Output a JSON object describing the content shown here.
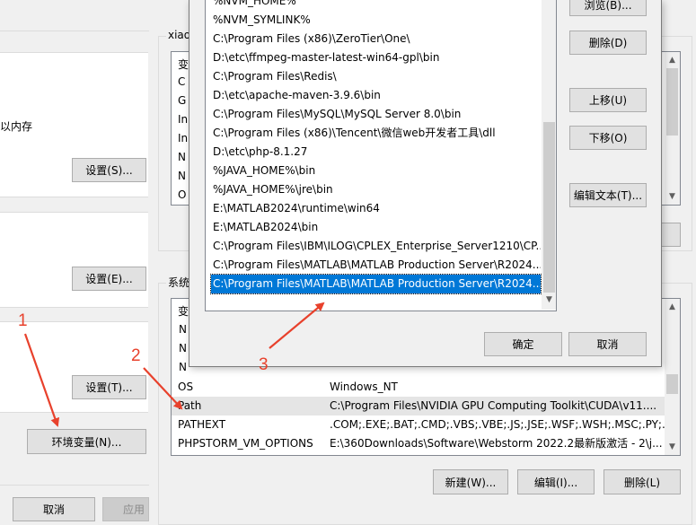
{
  "sys_props": {
    "memory_suffix": "以内存",
    "perf_settings": "设置(S)...",
    "profile_settings": "设置(E)...",
    "startup_settings": "设置(T)...",
    "env_vars_button": "环境变量(N)...",
    "cancel": "取消",
    "apply": "应用"
  },
  "env_dialog": {
    "user_group_label": "xiao",
    "user_var_fragments": [
      "变",
      "C",
      "G",
      "In",
      "In",
      "N",
      "N",
      "O"
    ],
    "system_group_label": "系统",
    "system_header_fragment": "变",
    "system_var_fragments": [
      "N",
      "N",
      "N"
    ],
    "system_vars": [
      {
        "name": "OS",
        "value": "Windows_NT"
      },
      {
        "name": "Path",
        "value": "C:\\Program Files\\NVIDIA GPU Computing Toolkit\\CUDA\\v11...."
      },
      {
        "name": "PATHEXT",
        "value": ".COM;.EXE;.BAT;.CMD;.VBS;.VBE;.JS;.JSE;.WSF;.WSH;.MSC;.PY;.P..."
      },
      {
        "name": "PHPSTORM_VM_OPTIONS",
        "value": "E:\\360Downloads\\Software\\Webstorm 2022.2最新版激活 - 2\\j..."
      }
    ],
    "new_button": "新建(W)...",
    "edit_button": "编辑(I)...",
    "delete_button": "删除(L)"
  },
  "edit_dialog": {
    "paths": [
      "%NVM_HOME%",
      "%NVM_SYMLINK%",
      "C:\\Program Files (x86)\\ZeroTier\\One\\",
      "D:\\etc\\ffmpeg-master-latest-win64-gpl\\bin",
      "C:\\Program Files\\Redis\\",
      "D:\\etc\\apache-maven-3.9.6\\bin",
      "C:\\Program Files\\MySQL\\MySQL Server 8.0\\bin",
      "C:\\Program Files (x86)\\Tencent\\微信web开发者工具\\dll",
      "D:\\etc\\php-8.1.27",
      "%JAVA_HOME%\\bin",
      "%JAVA_HOME%\\jre\\bin",
      "E:\\MATLAB2024\\runtime\\win64",
      "E:\\MATLAB2024\\bin",
      "C:\\Program Files\\IBM\\ILOG\\CPLEX_Enterprise_Server1210\\CP...",
      "C:\\Program Files\\MATLAB\\MATLAB Production Server\\R2024...",
      "C:\\Program Files\\MATLAB\\MATLAB Production Server\\R2024..."
    ],
    "selected_index": 15,
    "browse_button": "浏览(B)...",
    "delete_button": "删除(D)",
    "move_up_button": "上移(U)",
    "move_down_button": "下移(O)",
    "edit_text_button": "编辑文本(T)...",
    "ok_button": "确定",
    "cancel_button": "取消"
  },
  "annotations": {
    "label_1": "1",
    "label_2": "2",
    "label_3": "3",
    "color": "#e8412c"
  },
  "icons": [
    "scroll-up-arrow",
    "scroll-down-arrow",
    "annotation-arrow"
  ]
}
